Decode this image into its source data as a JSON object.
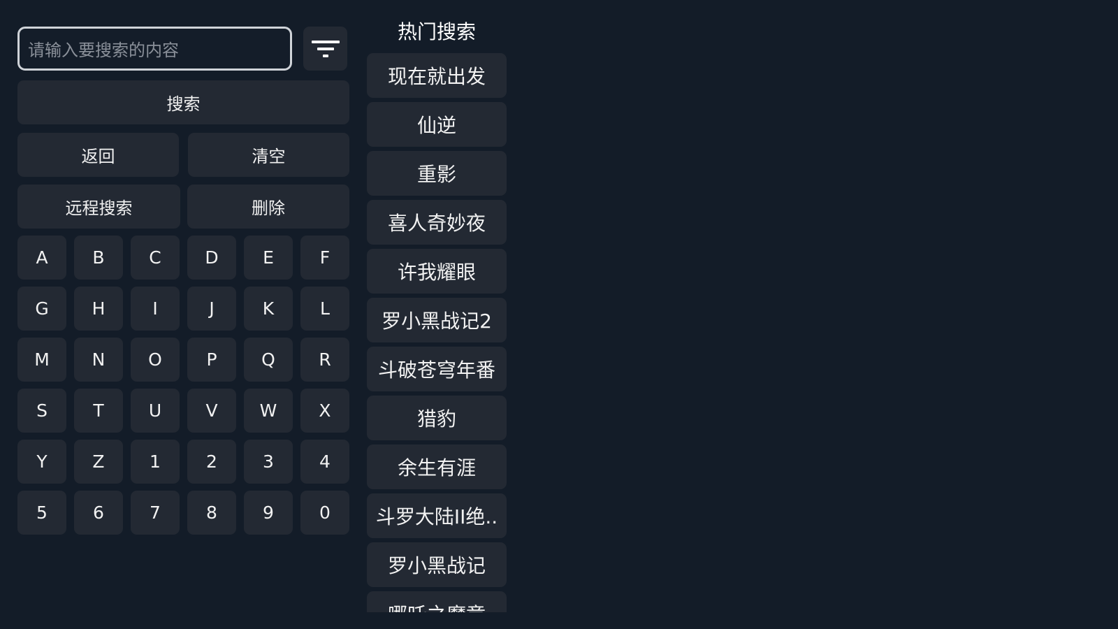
{
  "search": {
    "placeholder": "请输入要搜索的内容",
    "filter_icon": "filter-icon"
  },
  "actions": {
    "search_label": "搜索",
    "back_label": "返回",
    "clear_label": "清空",
    "remote_search_label": "远程搜索",
    "delete_label": "删除"
  },
  "keyboard": {
    "keys": [
      "A",
      "B",
      "C",
      "D",
      "E",
      "F",
      "G",
      "H",
      "I",
      "J",
      "K",
      "L",
      "M",
      "N",
      "O",
      "P",
      "Q",
      "R",
      "S",
      "T",
      "U",
      "V",
      "W",
      "X",
      "Y",
      "Z",
      "1",
      "2",
      "3",
      "4",
      "5",
      "6",
      "7",
      "8",
      "9",
      "0"
    ]
  },
  "hot_search": {
    "title": "热门搜索",
    "items": [
      "现在就出发",
      "仙逆",
      "重影",
      "喜人奇妙夜",
      "许我耀眼",
      "罗小黑战记2",
      "斗破苍穹年番",
      "猎豹",
      "余生有涯",
      "斗罗大陆II绝..",
      "罗小黑战记",
      "哪吒之魔童"
    ]
  },
  "colors": {
    "background": "#131c28",
    "button": "#232933",
    "input_border": "#cfd3d8",
    "placeholder": "#8a9099"
  }
}
